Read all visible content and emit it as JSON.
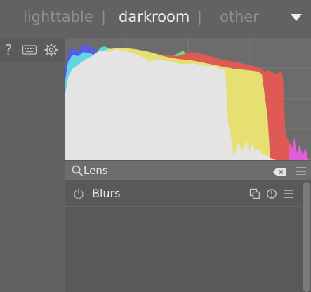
{
  "views": {
    "lighttable": "lighttable",
    "darkroom": "darkroom",
    "other": "other",
    "separator": "|"
  },
  "left_toolbar": {
    "help": "?"
  },
  "search": {
    "value": "Lens"
  },
  "modules": [
    {
      "label": "Blurs"
    }
  ],
  "colors": {
    "background": "#626262",
    "panel": "#595959",
    "histogram_bg": "#6c6c6c",
    "red": "#e05a55",
    "yellow": "#e6e070",
    "light": "#e4e4e4"
  },
  "icons": {
    "help": "question-icon",
    "keyboard": "keyboard-icon",
    "settings": "gear-icon",
    "search": "search-icon",
    "clear": "clear-icon",
    "presets": "menu-icon",
    "power": "power-icon",
    "instances": "instances-icon",
    "reset": "reset-icon"
  }
}
